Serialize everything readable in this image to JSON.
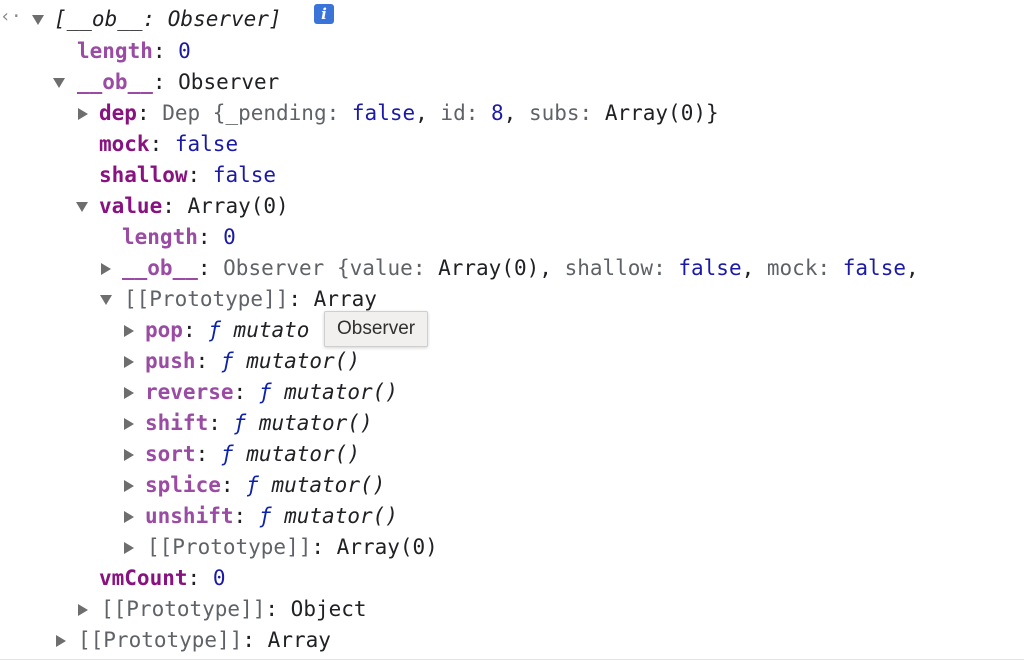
{
  "rows": [
    {
      "parts": [
        "[__ob__: Observer]"
      ]
    },
    {
      "key": "length",
      "sep": ": ",
      "value": "0"
    },
    {
      "key": "__ob__",
      "sep": ": ",
      "value": "Observer"
    },
    {
      "key": "dep",
      "sep": ": ",
      "parts": [
        "Dep {",
        "_pending",
        ": ",
        "false",
        ", ",
        "id",
        ": ",
        "8",
        ", ",
        "subs",
        ": ",
        "Array(0)",
        "}"
      ]
    },
    {
      "key": "mock",
      "sep": ": ",
      "value": "false"
    },
    {
      "key": "shallow",
      "sep": ": ",
      "value": "false"
    },
    {
      "key": "value",
      "sep": ": ",
      "value": "Array(0)"
    },
    {
      "key": "length",
      "sep": ": ",
      "value": "0"
    },
    {
      "key": "__ob__",
      "sep": ": ",
      "parts": [
        "Observer {",
        "value",
        ": ",
        "Array(0)",
        ", ",
        "shallow",
        ": ",
        "false",
        ", ",
        "mock",
        ": ",
        "false",
        ","
      ]
    },
    {
      "key": "[[Prototype]]",
      "sep": ": ",
      "value": "Array"
    },
    {
      "key": "pop",
      "sep": ": ",
      "fn": "ƒ",
      "value": "mutato"
    },
    {
      "key": "push",
      "sep": ": ",
      "fn": "ƒ",
      "value": "mutator()"
    },
    {
      "key": "reverse",
      "sep": ": ",
      "fn": "ƒ",
      "value": "mutator()"
    },
    {
      "key": "shift",
      "sep": ": ",
      "fn": "ƒ",
      "value": "mutator()"
    },
    {
      "key": "sort",
      "sep": ": ",
      "fn": "ƒ",
      "value": "mutator()"
    },
    {
      "key": "splice",
      "sep": ": ",
      "fn": "ƒ",
      "value": "mutator()"
    },
    {
      "key": "unshift",
      "sep": ": ",
      "fn": "ƒ",
      "value": "mutator()"
    },
    {
      "key": "[[Prototype]]",
      "sep": ": ",
      "value": "Array(0)"
    },
    {
      "key": "vmCount",
      "sep": ": ",
      "value": "0"
    },
    {
      "key": "[[Prototype]]",
      "sep": ": ",
      "value": "Object"
    },
    {
      "key": "[[Prototype]]",
      "sep": ": ",
      "value": "Array"
    }
  ],
  "icons": {
    "back": "‹·",
    "info": "i"
  },
  "tooltip": "Observer",
  "colors": {
    "key": "#881280",
    "value_literal": "#1a1aa6",
    "function": "#0d22aa",
    "internal": "#5f6368",
    "info_badge": "#3b74d9"
  }
}
